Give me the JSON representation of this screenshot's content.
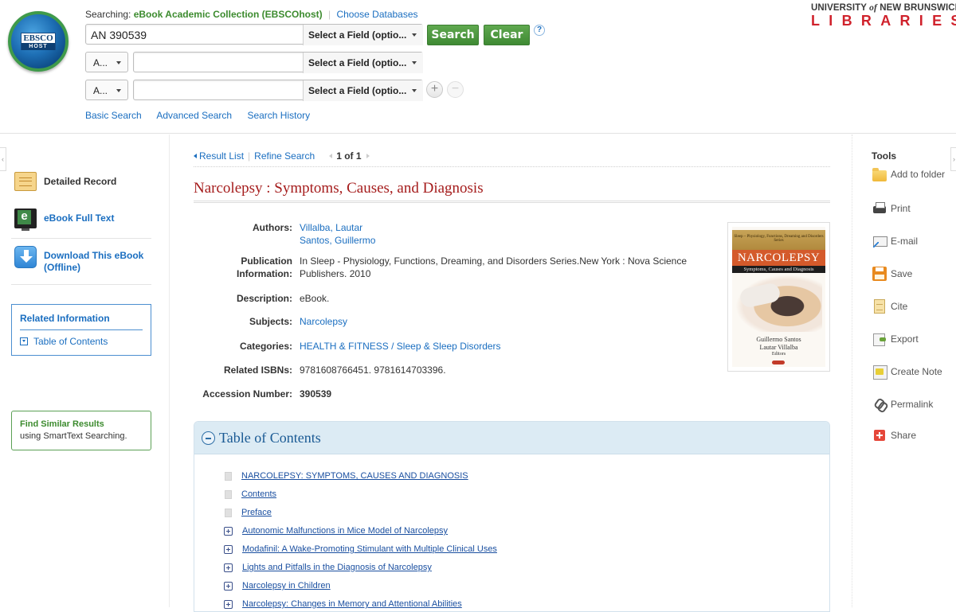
{
  "header": {
    "logo": {
      "top": "EBSCO",
      "bottom": "HOST"
    },
    "searching_label": "Searching:",
    "database": "eBook Academic Collection (EBSCOhost)",
    "choose_databases": "Choose Databases",
    "rows": [
      {
        "bool": "",
        "query": "AN 390539",
        "field": "Select a Field (optio..."
      },
      {
        "bool": "A...",
        "query": "",
        "field": "Select a Field (optio..."
      },
      {
        "bool": "A...",
        "query": "",
        "field": "Select a Field (optio..."
      }
    ],
    "search_button": "Search",
    "clear_button": "Clear",
    "help": "?",
    "add_row": "+",
    "remove_row": "−",
    "links": [
      "Basic Search",
      "Advanced Search",
      "Search History"
    ],
    "institution": {
      "line1_a": "UNIVERSITY",
      "line1_of": "of",
      "line1_b": "NEW BRUNSWICK",
      "line2": "LIBRARIES"
    }
  },
  "left_panel": {
    "items": [
      {
        "label": "Detailed Record",
        "icon": "detailed-record-icon"
      },
      {
        "label": "eBook Full Text",
        "icon": "ebook-full-text-icon"
      },
      {
        "label": "Download This eBook (Offline)",
        "icon": "download-icon"
      }
    ],
    "related": {
      "title": "Related Information",
      "link": "Table of Contents"
    },
    "similar": {
      "title": "Find Similar Results",
      "subtitle": "using SmartText Searching."
    }
  },
  "nav": {
    "result_list": "Result List",
    "refine_search": "Refine Search",
    "position": "1 of 1"
  },
  "record": {
    "title": "Narcolepsy : Symptoms, Causes, and Diagnosis",
    "authors_label": "Authors:",
    "authors": [
      "Villalba, Lautar",
      "Santos, Guillermo"
    ],
    "pub_label_1": "Publication",
    "pub_label_2": "Information:",
    "pub_line_1": "In Sleep - Physiology, Functions, Dreaming, and Disorders Series.New York : Nova Science",
    "pub_line_2": "Publishers. 2010",
    "description_label": "Description:",
    "description": "eBook.",
    "subjects_label": "Subjects:",
    "subjects": "Narcolepsy",
    "categories_label": "Categories:",
    "categories": "HEALTH & FITNESS / Sleep & Sleep Disorders",
    "isbns_label": "Related ISBNs:",
    "isbns": "9781608766451. 9781614703396.",
    "accession_label": "Accession Number:",
    "accession": "390539",
    "cover": {
      "series": "Sleep – Physiology, Functions, Dreaming and Disorders Series",
      "title": "NARCOLEPSY",
      "subtitle": "Symptoms, Causes and Diagnosis",
      "editor1": "Guillermo Santos",
      "editor2": "Lautar Villalba",
      "editors_label": "Editors"
    }
  },
  "toc": {
    "title": "Table of Contents",
    "items": [
      {
        "label": "NARCOLEPSY: SYMPTOMS, CAUSES AND DIAGNOSIS",
        "expandable": false
      },
      {
        "label": "Contents",
        "expandable": false
      },
      {
        "label": "Preface",
        "expandable": false
      },
      {
        "label": "Autonomic Malfunctions in Mice Model of Narcolepsy",
        "expandable": true
      },
      {
        "label": "Modafinil: A Wake-Promoting Stimulant with Multiple Clinical Uses",
        "expandable": true
      },
      {
        "label": "Lights and Pitfalls in the Diagnosis of Narcolepsy",
        "expandable": true
      },
      {
        "label": "Narcolepsy in Children",
        "expandable": true
      },
      {
        "label": "Narcolepsy: Changes in Memory and Attentional Abilities",
        "expandable": true
      }
    ]
  },
  "tools": {
    "title": "Tools",
    "items": [
      {
        "label": "Add to folder",
        "icon": "add-to-folder-icon"
      },
      {
        "label": "Print",
        "icon": "print-icon"
      },
      {
        "label": "E-mail",
        "icon": "email-icon"
      },
      {
        "label": "Save",
        "icon": "save-icon"
      },
      {
        "label": "Cite",
        "icon": "cite-icon"
      },
      {
        "label": "Export",
        "icon": "export-icon"
      },
      {
        "label": "Create Note",
        "icon": "create-note-icon"
      },
      {
        "label": "Permalink",
        "icon": "permalink-icon"
      },
      {
        "label": "Share",
        "icon": "share-icon"
      }
    ]
  }
}
